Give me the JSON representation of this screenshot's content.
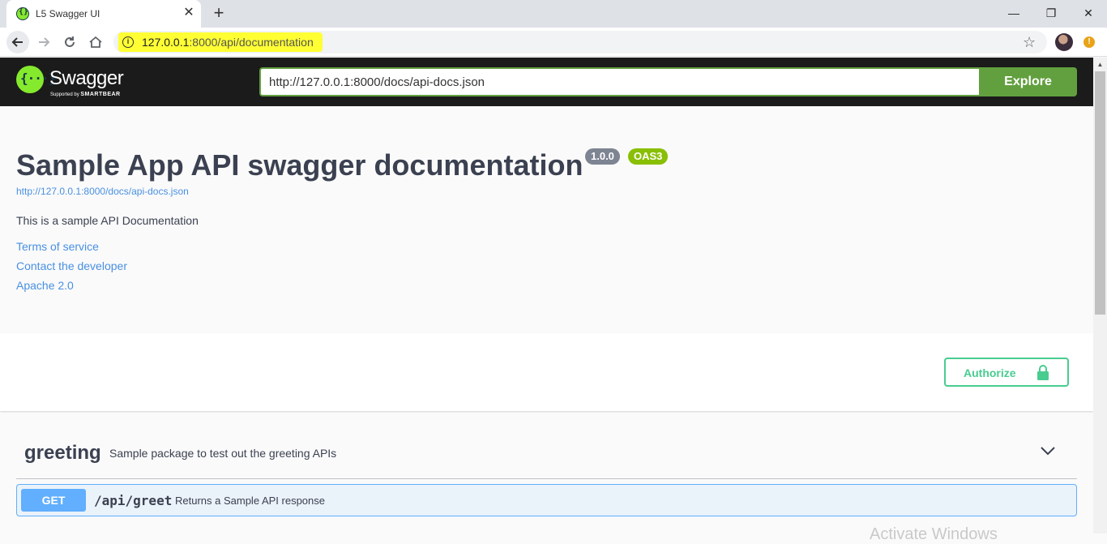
{
  "browser": {
    "tab_title": "L5 Swagger UI",
    "tab_close": "✕",
    "new_tab": "+",
    "minimize": "—",
    "restore": "❐",
    "close": "✕",
    "url_host": "127.0.0.1",
    "url_rest": ":8000/api/documentation",
    "info_glyph": "i",
    "bookmark_glyph": "☆",
    "alert_glyph": "!"
  },
  "topbar": {
    "logo_word": "Swagger",
    "logo_sub_prefix": "Supported by",
    "logo_sub_brand": "SMARTBEAR",
    "spec_url": "http://127.0.0.1:8000/docs/api-docs.json",
    "explore_label": "Explore"
  },
  "info": {
    "title": "Sample App API swagger documentation",
    "version": "1.0.0",
    "oas": "OAS3",
    "spec_link": "http://127.0.0.1:8000/docs/api-docs.json",
    "description": "This is a sample API Documentation",
    "links": [
      "Terms of service",
      "Contact the developer",
      "Apache 2.0"
    ]
  },
  "schemes": {
    "authorize_label": "Authorize"
  },
  "tags": [
    {
      "name": "greeting",
      "description": "Sample package to test out the greeting APIs",
      "operations": [
        {
          "method": "GET",
          "path": "/api/greet",
          "summary": "Returns a Sample API response"
        }
      ]
    }
  ],
  "os": {
    "watermark": "Activate Windows"
  },
  "colors": {
    "swagger_green": "#85ea2d",
    "explore_green": "#62a03f",
    "get_blue": "#61affe",
    "authorize_green": "#49cc90"
  }
}
